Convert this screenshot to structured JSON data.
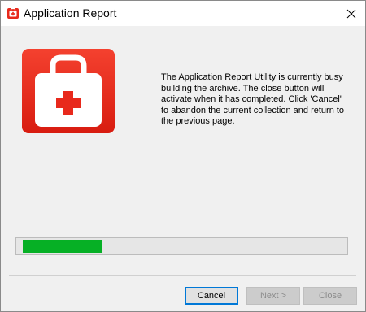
{
  "window": {
    "title": "Application Report",
    "title_icon": "first-aid-kit-icon",
    "close_icon": "close-icon"
  },
  "main": {
    "app_icon": "first-aid-kit-icon",
    "message_lines": [
      "The Application Report Utility is currently busy",
      "building the archive. The close button will",
      "activate when it has completed. Click 'Cancel'",
      "to abandon the current collection and return to",
      "the previous page."
    ],
    "progress": 0.25
  },
  "buttons": {
    "cancel_label": "Cancel",
    "next_label": "Next >",
    "close_label": "Close"
  },
  "colors": {
    "progress_fill": "#06b025",
    "icon_red": "#e8291c",
    "focus_border": "#0078d7"
  }
}
